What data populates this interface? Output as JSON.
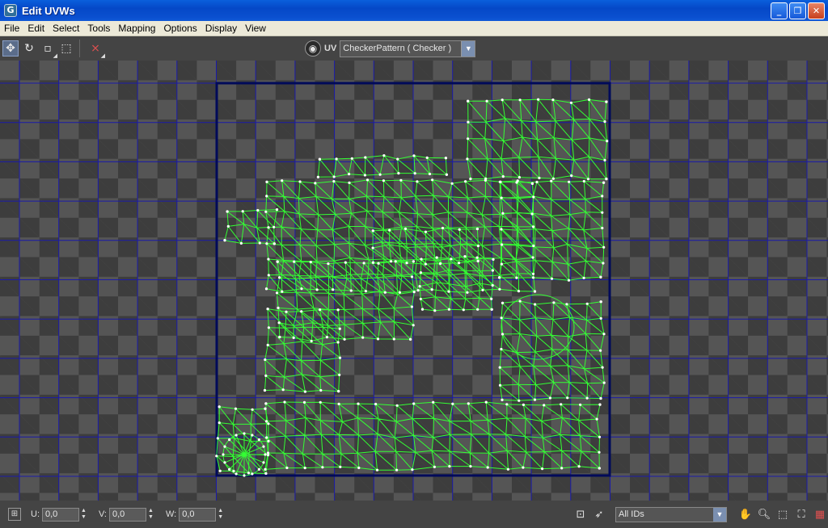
{
  "window": {
    "title": "Edit UVWs",
    "app_icon": "G",
    "minimize_icon": "minimize-icon",
    "maximize_icon": "maximize-icon",
    "close_icon": "close-icon"
  },
  "menu": {
    "items": [
      "File",
      "Edit",
      "Select",
      "Tools",
      "Mapping",
      "Options",
      "Display",
      "View"
    ]
  },
  "toolbar": {
    "tools": [
      {
        "name": "move-icon",
        "glyph": "✥"
      },
      {
        "name": "rotate-icon",
        "glyph": "↻"
      },
      {
        "name": "scale-icon",
        "glyph": "▫"
      },
      {
        "name": "freeform-icon",
        "glyph": "⬚"
      },
      {
        "name": "mirror-icon",
        "glyph": "⨯"
      }
    ],
    "uv_label": "UV",
    "texture_select": "CheckerPattern  ( Checker )"
  },
  "statusbar": {
    "u_label": "U:",
    "u_value": "0,0",
    "v_label": "V:",
    "v_value": "0,0",
    "w_label": "W:",
    "w_value": "0,0",
    "id_filter": "All IDs"
  },
  "colors": {
    "mesh_green": "#33ff33",
    "vertex_white": "#ffffff",
    "grid_blue": "#1a1aaa",
    "uv_border": "#000a5a"
  }
}
